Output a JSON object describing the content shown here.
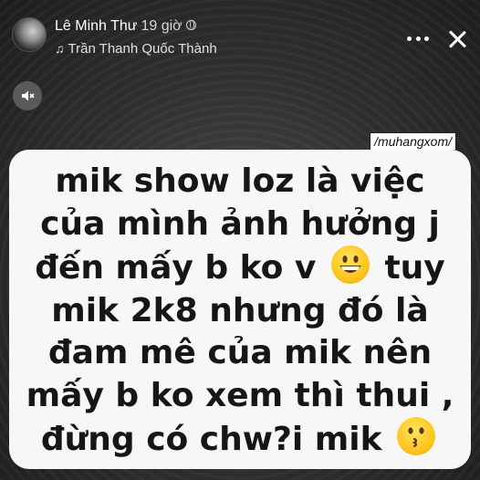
{
  "header": {
    "author_name": "Lê Minh Thư",
    "post_time": "19 giờ",
    "privacy_icon": "globe-icon",
    "music_icon": "music-note-icon",
    "music_artist": "Trần Thanh Quốc Thành",
    "more_icon": "more-dots-icon",
    "close_icon": "close-icon"
  },
  "audio": {
    "mute_icon": "speaker-muted-icon"
  },
  "watermark": "/muhangxom/",
  "story": {
    "lines": [
      "mik show loz là việc",
      "của mình ảnh hưởng j",
      "đến mấy b ko v",
      "tuy",
      "mik 2k8 nhưng đó là",
      "đam mê của mik nên",
      "mấy b ko xem thì thui ,",
      "đừng có chw?i mik"
    ],
    "emoji_1": "grinning-face-emoji",
    "emoji_2": "kissing-face-emoji"
  },
  "colors": {
    "background": "#2e2e2e",
    "panel": "#f7f7f7",
    "text": "#161616",
    "emoji": "#ffc21a"
  }
}
